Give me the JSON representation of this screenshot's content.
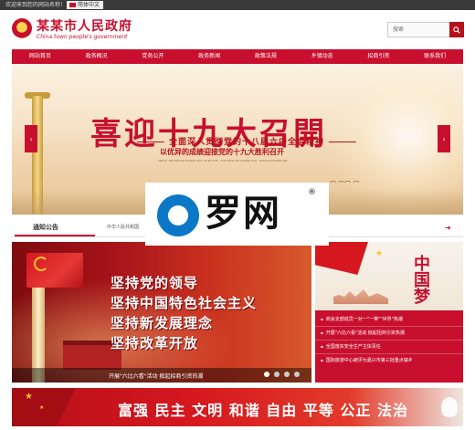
{
  "topbar": {
    "welcome": "欢迎来到您的网站名称！",
    "lang_label": "简体中文"
  },
  "header": {
    "site_title": "某某市人民政府",
    "site_subtitle": "China town people's government",
    "search_placeholder": "搜索"
  },
  "nav": {
    "items": [
      {
        "label": "网站首页"
      },
      {
        "label": "政务概况"
      },
      {
        "label": "党务公开"
      },
      {
        "label": "政务新闻"
      },
      {
        "label": "政策法规"
      },
      {
        "label": "乡镇动态"
      },
      {
        "label": "招商引资"
      },
      {
        "label": "联系我们"
      }
    ]
  },
  "banner": {
    "headline": "喜迎十九大召開",
    "sub1": "全面深入贯彻党的十八届六中全会精神",
    "sub2": "以优异的成绩迎接党的十九大胜利召开",
    "sub3": "AND IF THE WHOLE WORLD WILL IN MY EYE · FOR FEAR OF LOSING YOU · WOULD RATHER CRY"
  },
  "notice": {
    "label": "通知公告",
    "text": "中华人民共和国"
  },
  "watermark": {
    "brand": "罗网",
    "reg": "®"
  },
  "feature": {
    "lines": [
      "坚持党的领导",
      "坚持中国特色社会主义",
      "坚持新发展理念",
      "坚持改革开放"
    ],
    "caption": "开展\"六比六看\"活动 掀起招商引资热潮",
    "slides": 4,
    "active_slide": 1
  },
  "side": {
    "image_text": "中国梦",
    "news": [
      "商会支部成员一对一\"一带\"\"世界\"热潮",
      "开展\"六比六看\"活动 掀起招商引资热潮",
      "全国落实安全生产主体责任",
      "国际旅游中心被评为嘉兴市第三批重点镇乡"
    ]
  },
  "slogan": {
    "text": "富强 民主 文明 和谐   自由 平等 公正 法治"
  },
  "colors": {
    "primary": "#c8102e",
    "dark_red": "#b5121b",
    "topbar": "#3a3a3a",
    "gold": "#f4c430"
  }
}
